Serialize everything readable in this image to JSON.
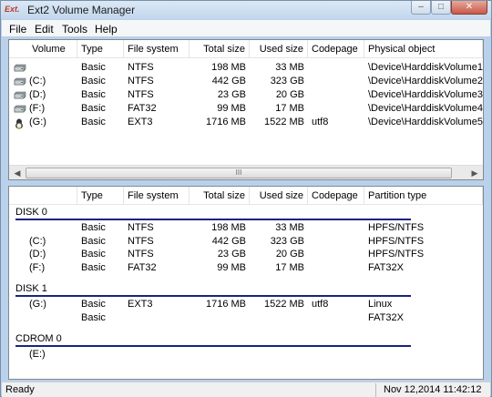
{
  "window": {
    "title": "Ext2 Volume Manager",
    "icon_text": "Ext.",
    "min": "–",
    "max": "□",
    "close": "✕"
  },
  "menu": [
    "File",
    "Edit",
    "Tools",
    "Help"
  ],
  "volumes": {
    "headers": [
      "Volume",
      "Type",
      "File system",
      "Total size",
      "Used size",
      "Codepage",
      "Physical object"
    ],
    "rows": [
      {
        "volume": "",
        "type": "Basic",
        "fs": "NTFS",
        "total": "198 MB",
        "used": "33 MB",
        "codepage": "",
        "object": "\\Device\\HarddiskVolume1",
        "icon": "hard-disk-icon"
      },
      {
        "volume": "(C:)",
        "type": "Basic",
        "fs": "NTFS",
        "total": "442 GB",
        "used": "323 GB",
        "codepage": "",
        "object": "\\Device\\HarddiskVolume2",
        "icon": "hard-disk-icon"
      },
      {
        "volume": "(D:)",
        "type": "Basic",
        "fs": "NTFS",
        "total": "23 GB",
        "used": "20 GB",
        "codepage": "",
        "object": "\\Device\\HarddiskVolume3",
        "icon": "hard-disk-icon"
      },
      {
        "volume": "(F:)",
        "type": "Basic",
        "fs": "FAT32",
        "total": "99 MB",
        "used": "17 MB",
        "codepage": "",
        "object": "\\Device\\HarddiskVolume4",
        "icon": "hard-disk-icon"
      },
      {
        "volume": "(G:)",
        "type": "Basic",
        "fs": "EXT3",
        "total": "1716 MB",
        "used": "1522 MB",
        "codepage": "utf8",
        "object": "\\Device\\HarddiskVolume5",
        "icon": "linux-disk-icon"
      }
    ],
    "scroll_grip": "III"
  },
  "partitions": {
    "headers": [
      "",
      "Type",
      "File system",
      "Total size",
      "Used size",
      "Codepage",
      "Partition type"
    ],
    "disks": [
      {
        "label": "DISK 0",
        "rows": [
          {
            "volume": "",
            "type": "Basic",
            "fs": "NTFS",
            "total": "198 MB",
            "used": "33 MB",
            "codepage": "",
            "ptype": "HPFS/NTFS"
          },
          {
            "volume": "(C:)",
            "type": "Basic",
            "fs": "NTFS",
            "total": "442 GB",
            "used": "323 GB",
            "codepage": "",
            "ptype": "HPFS/NTFS"
          },
          {
            "volume": "(D:)",
            "type": "Basic",
            "fs": "NTFS",
            "total": "23 GB",
            "used": "20 GB",
            "codepage": "",
            "ptype": "HPFS/NTFS"
          },
          {
            "volume": "(F:)",
            "type": "Basic",
            "fs": "FAT32",
            "total": "99 MB",
            "used": "17 MB",
            "codepage": "",
            "ptype": "FAT32X"
          }
        ]
      },
      {
        "label": "DISK 1",
        "rows": [
          {
            "volume": "(G:)",
            "type": "Basic",
            "fs": "EXT3",
            "total": "1716 MB",
            "used": "1522 MB",
            "codepage": "utf8",
            "ptype": "Linux"
          },
          {
            "volume": "",
            "type": "Basic",
            "fs": "",
            "total": "",
            "used": "",
            "codepage": "",
            "ptype": "FAT32X"
          }
        ]
      },
      {
        "label": "CDROM 0",
        "rows": [
          {
            "volume": "(E:)",
            "type": "",
            "fs": "",
            "total": "",
            "used": "",
            "codepage": "",
            "ptype": ""
          }
        ]
      }
    ]
  },
  "status": {
    "left": "Ready",
    "right": "Nov 12,2014 11:42:12"
  }
}
